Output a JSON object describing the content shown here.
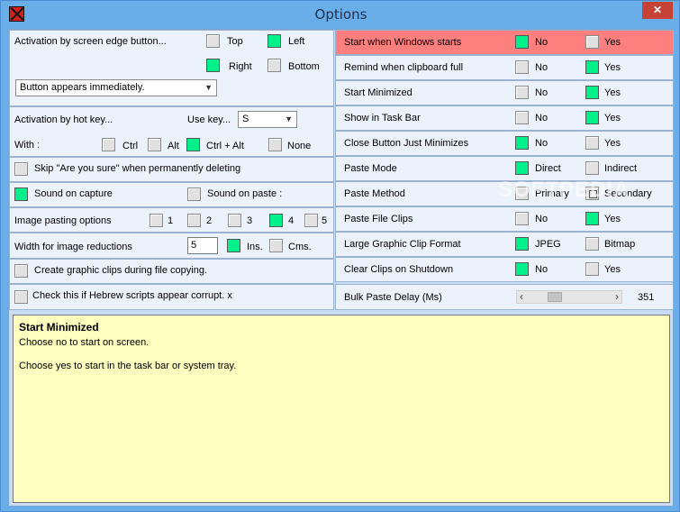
{
  "window": {
    "title": "Options",
    "close_glyph": "✕"
  },
  "left": {
    "edge": {
      "label": "Activation by screen edge button...",
      "top": {
        "label": "Top",
        "checked": false
      },
      "left": {
        "label": "Left",
        "checked": true
      },
      "right": {
        "label": "Right",
        "checked": true
      },
      "bottom": {
        "label": "Bottom",
        "checked": false
      },
      "dropdown_value": "Button appears immediately."
    },
    "hotkey": {
      "label": "Activation by hot key...",
      "use_key_label": "Use key...",
      "key_value": "S",
      "with_label": "With :",
      "ctrl": {
        "label": "Ctrl",
        "checked": false
      },
      "alt": {
        "label": "Alt",
        "checked": false
      },
      "ctrl_alt": {
        "label": "Ctrl + Alt",
        "checked": true
      },
      "none": {
        "label": "None",
        "checked": false
      }
    },
    "skip": {
      "label": "Skip \"Are you sure\" when permanently deleting",
      "checked": false
    },
    "sound_capture": {
      "label": "Sound on capture",
      "checked": true
    },
    "sound_paste": {
      "label": "Sound on paste :",
      "checked": false
    },
    "image_paste": {
      "label": "Image pasting options",
      "options": [
        {
          "label": "1",
          "checked": false
        },
        {
          "label": "2",
          "checked": false
        },
        {
          "label": "3",
          "checked": false
        },
        {
          "label": "4",
          "checked": true
        },
        {
          "label": "5",
          "checked": false
        }
      ]
    },
    "width": {
      "label": "Width for image reductions",
      "value": "5",
      "ins": {
        "label": "Ins.",
        "checked": true
      },
      "cms": {
        "label": "Cms.",
        "checked": false
      }
    },
    "create_clips": {
      "label": "Create graphic clips during file copying.",
      "checked": false
    },
    "hebrew": {
      "label": "Check this if Hebrew scripts appear corrupt. x",
      "checked": false
    }
  },
  "right": {
    "rows": [
      {
        "label": "Start when Windows starts",
        "opt1": "No",
        "opt1_on": true,
        "opt2": "Yes",
        "opt2_on": false
      },
      {
        "label": "Remind when clipboard full",
        "opt1": "No",
        "opt1_on": false,
        "opt2": "Yes",
        "opt2_on": true
      },
      {
        "label": "Start Minimized",
        "opt1": "No",
        "opt1_on": false,
        "opt2": "Yes",
        "opt2_on": true
      },
      {
        "label": "Show in Task Bar",
        "opt1": "No",
        "opt1_on": false,
        "opt2": "Yes",
        "opt2_on": true
      },
      {
        "label": "Close Button Just Minimizes",
        "opt1": "No",
        "opt1_on": true,
        "opt2": "Yes",
        "opt2_on": false
      },
      {
        "label": "Paste Mode",
        "opt1": "Direct",
        "opt1_on": true,
        "opt2": "Indirect",
        "opt2_on": false
      },
      {
        "label": "Paste Method",
        "opt1": "Primary",
        "opt1_on": false,
        "opt2": "Secondary",
        "opt2_on": false
      },
      {
        "label": "Paste File Clips",
        "opt1": "No",
        "opt1_on": false,
        "opt2": "Yes",
        "opt2_on": true
      },
      {
        "label": "Large Graphic Clip Format",
        "opt1": "JPEG",
        "opt1_on": true,
        "opt2": "Bitmap",
        "opt2_on": false
      },
      {
        "label": "Clear Clips on Shutdown",
        "opt1": "No",
        "opt1_on": true,
        "opt2": "Yes",
        "opt2_on": false
      }
    ],
    "bulk": {
      "label": "Bulk Paste Delay (Ms)",
      "value": "351",
      "slider_fraction": 0.25
    }
  },
  "info": {
    "title": "Start Minimized",
    "line1": "Choose no to start on screen.",
    "line2": "Choose yes to start in the task bar or system tray."
  },
  "watermark": "SOFTPEDIA",
  "colors": {
    "checked": "#00f08a",
    "highlight_row": "#ff7f7f",
    "info_bg": "#ffffc0"
  }
}
